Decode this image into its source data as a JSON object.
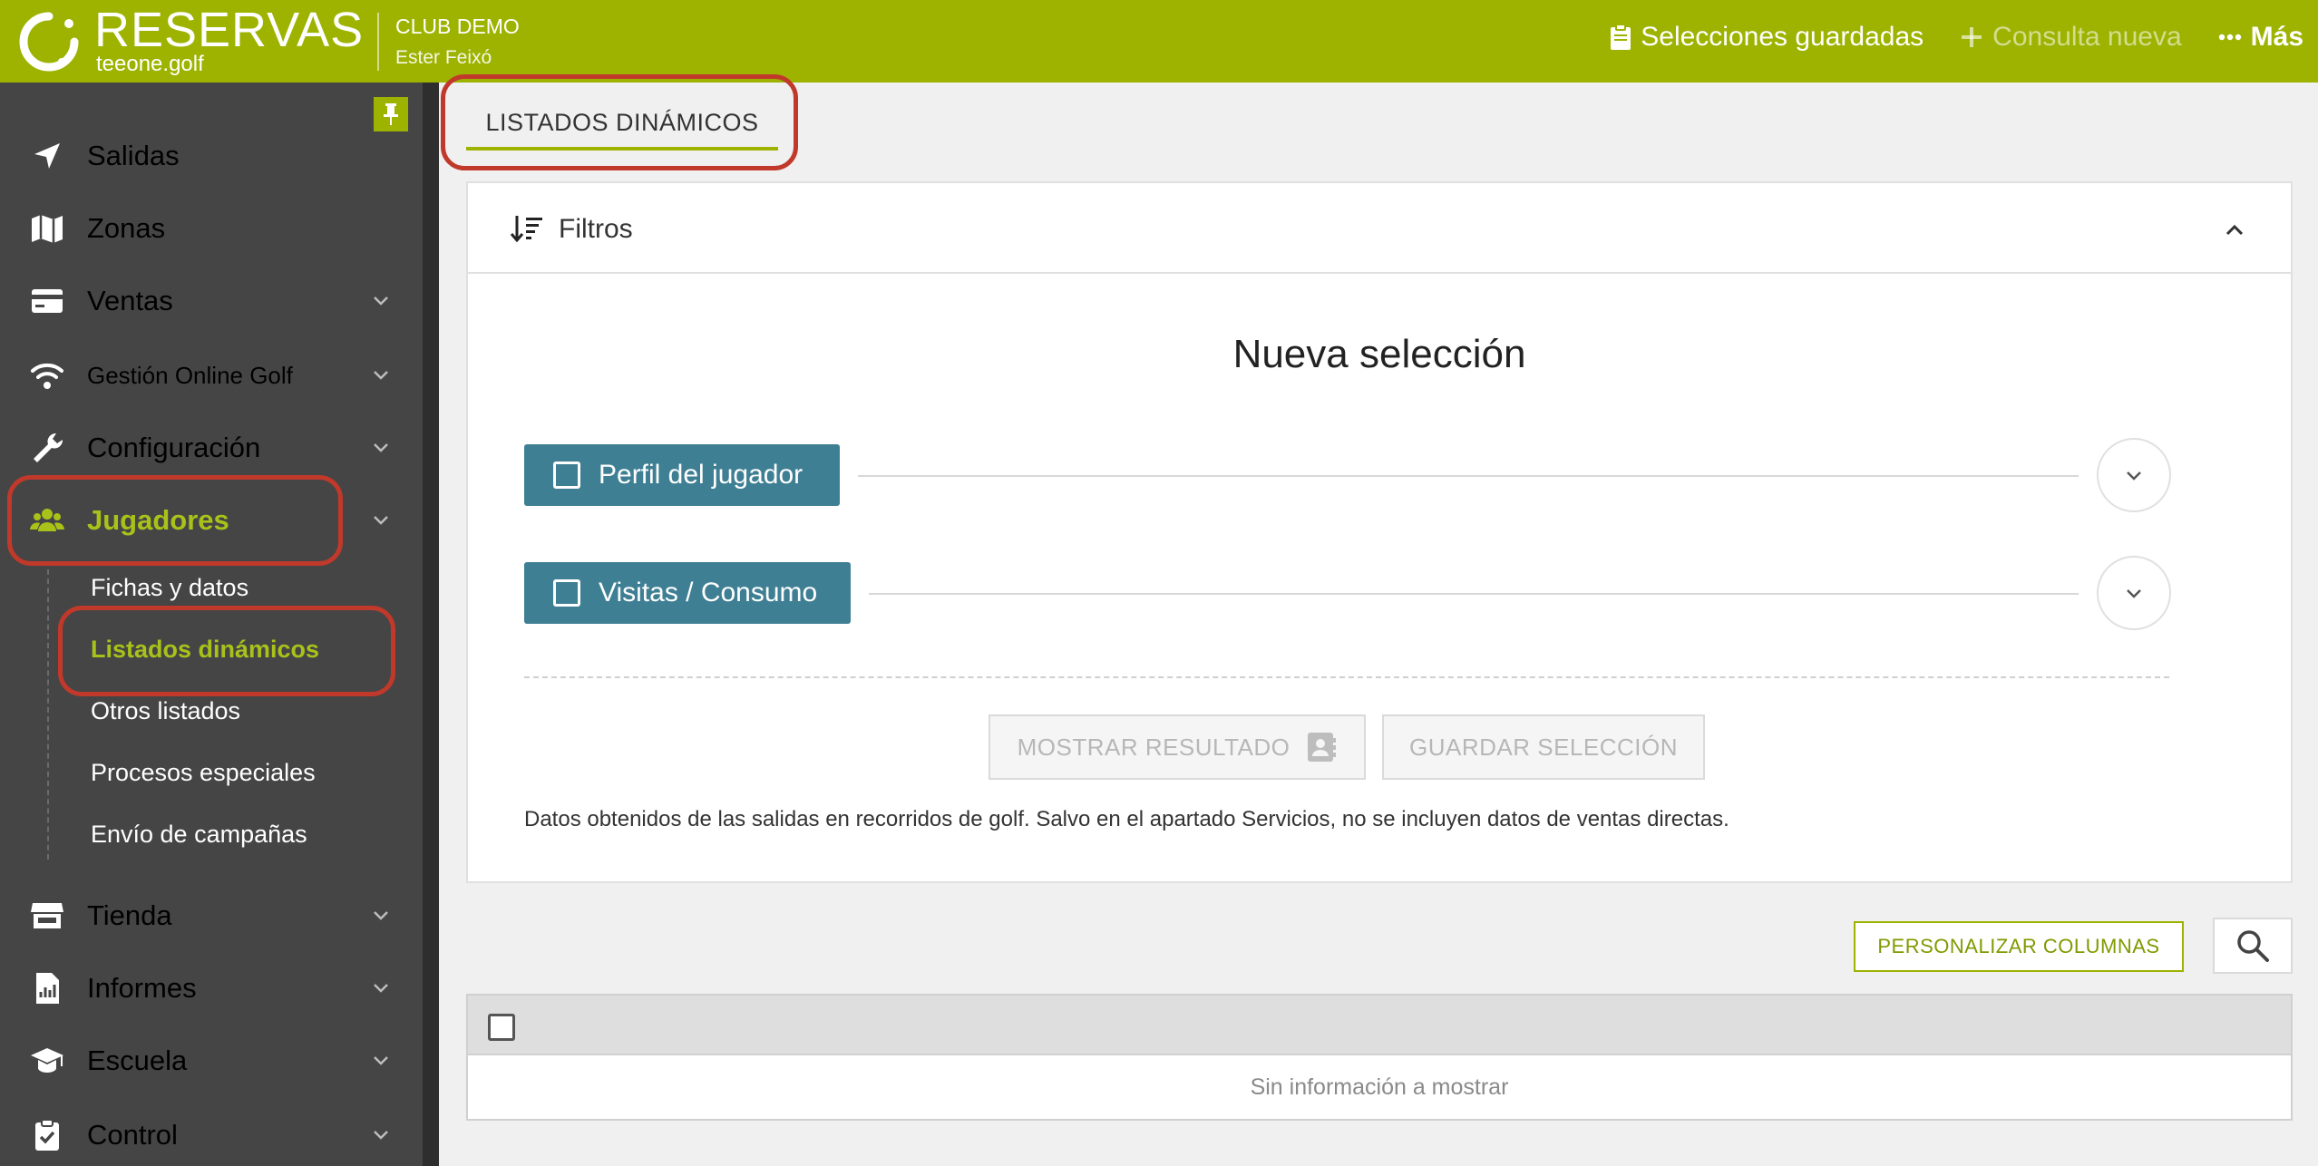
{
  "header": {
    "brand": "RESERVAS",
    "brand_sub": "teeone.golf",
    "club": "CLUB DEMO",
    "user": "Ester Feixó",
    "actions": [
      {
        "label": "Selecciones guardadas",
        "icon": "clipboard-icon",
        "enabled": true
      },
      {
        "label": "Consulta nueva",
        "icon": "plus-icon",
        "enabled": false
      },
      {
        "label": "Más",
        "icon": "ellipsis-icon",
        "enabled": true
      }
    ]
  },
  "sidebar": {
    "items": [
      {
        "label": "Salidas",
        "icon": "location-arrow-icon",
        "has_children": false
      },
      {
        "label": "Zonas",
        "icon": "map-icon",
        "has_children": false
      },
      {
        "label": "Ventas",
        "icon": "credit-card-icon",
        "has_children": true
      },
      {
        "label": "Gestión Online Golf",
        "icon": "wifi-icon",
        "has_children": true
      },
      {
        "label": "Configuración",
        "icon": "wrench-icon",
        "has_children": true
      },
      {
        "label": "Jugadores",
        "icon": "users-icon",
        "has_children": true,
        "active": true
      },
      {
        "label": "Tienda",
        "icon": "store-icon",
        "has_children": true
      },
      {
        "label": "Informes",
        "icon": "file-chart-icon",
        "has_children": true
      },
      {
        "label": "Escuela",
        "icon": "graduation-cap-icon",
        "has_children": true
      },
      {
        "label": "Control",
        "icon": "clipboard-check-icon",
        "has_children": true
      }
    ],
    "subitems": [
      {
        "label": "Fichas y datos"
      },
      {
        "label": "Listados dinámicos",
        "active": true
      },
      {
        "label": "Otros listados"
      },
      {
        "label": "Procesos especiales"
      },
      {
        "label": "Envío de campañas"
      }
    ]
  },
  "main": {
    "tab": "LISTADOS DINÁMICOS",
    "filters": {
      "title": "Filtros",
      "selection_title": "Nueva selección",
      "groups": [
        {
          "label": "Perfil del jugador"
        },
        {
          "label": "Visitas / Consumo"
        }
      ],
      "show_result": "MOSTRAR RESULTADO",
      "save_selection": "GUARDAR SELECCIÓN",
      "note": "Datos obtenidos de las salidas en recorridos de golf. Salvo en el apartado Servicios, no se incluyen datos de ventas directas."
    },
    "customize_columns": "PERSONALIZAR COLUMNAS",
    "table": {
      "empty_text": "Sin información a mostrar"
    }
  },
  "colors": {
    "accent": "#9db300",
    "sidebar_bg": "#454545",
    "group_button": "#3f7f94",
    "highlight": "#c0392b"
  }
}
